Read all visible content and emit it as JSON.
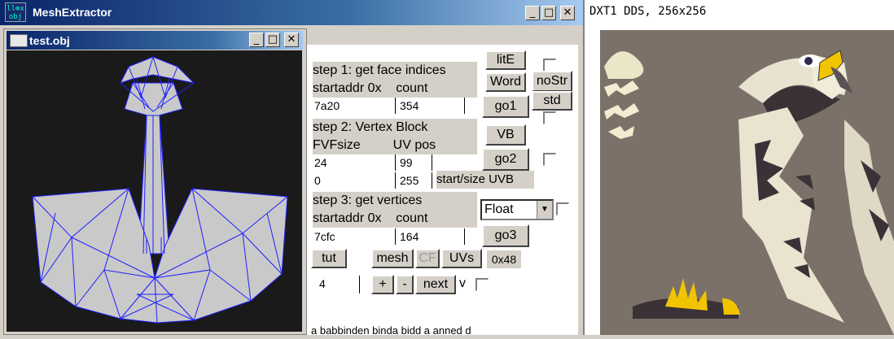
{
  "main_window": {
    "title": "MeshExtractor",
    "icon_lines": [
      "ll⊗x",
      "obj"
    ],
    "buttons": {
      "minimize": "_",
      "maximize": "□",
      "close": "✕"
    }
  },
  "child_window": {
    "title": "test.obj",
    "buttons": {
      "minimize": "_",
      "maximize": "□",
      "close": "✕"
    }
  },
  "panel": {
    "step1": {
      "title": "step 1: get face indices",
      "sub": "startaddr 0x    count",
      "startaddr": "7a20",
      "count": "354"
    },
    "step2": {
      "title": "step 2: Vertex Block",
      "sub": "FVFsize         UV pos",
      "fvfsize": "24",
      "uvpos": "99",
      "start": "0",
      "size": "255",
      "uvb_label": "start/size UVB"
    },
    "step3": {
      "title": "step 3: get vertices",
      "sub": "startaddr 0x    count",
      "startaddr": "7cfc",
      "count": "164"
    },
    "buttons": {
      "litE": "litE",
      "word": "Word",
      "nostr": "noStr",
      "go1": "go1",
      "std": "std",
      "vb": "VB",
      "go2": "go2",
      "go3": "go3",
      "tut": "tut",
      "mesh": "mesh",
      "cf": "CF",
      "uvs": "UVs",
      "hex": "0x48",
      "plus": "+",
      "minus": "-",
      "next": "next",
      "v": "v"
    },
    "float_select": "Float",
    "step_value": "4",
    "bottom_text": "a   babbinden binda bidd a   anned d"
  },
  "texture_view": {
    "label": "DXT1 DDS, 256x256"
  },
  "colors": {
    "titlebar": "#0a246a",
    "mesh_fill": "#c8c8c8",
    "mesh_edge": "#1a1aff",
    "texture_bg": "#7b7168"
  }
}
